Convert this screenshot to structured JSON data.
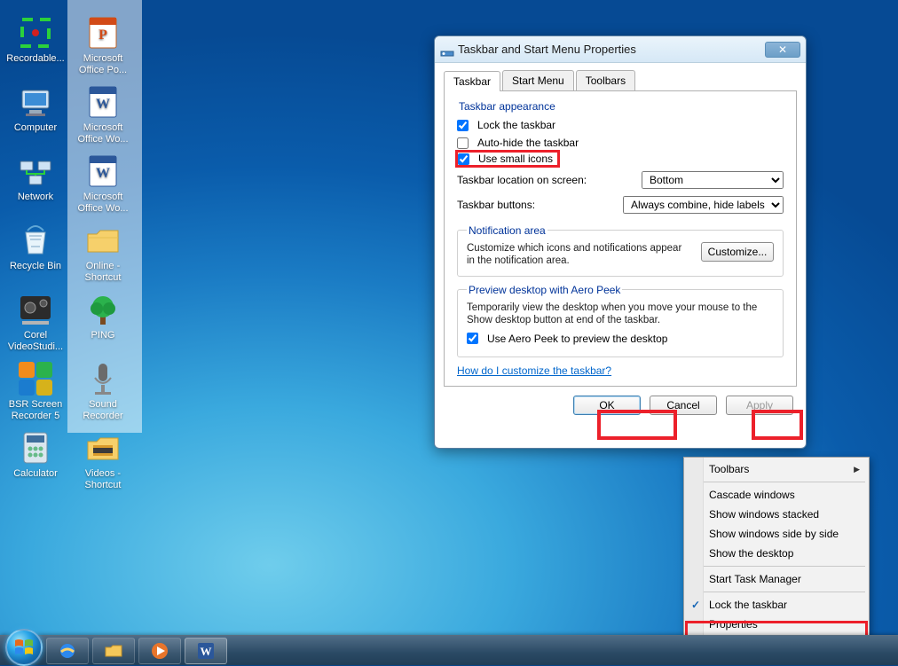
{
  "desktop": {
    "col1": [
      {
        "label": "Recordable...",
        "icon": "record"
      },
      {
        "label": "Computer",
        "icon": "computer"
      },
      {
        "label": "Network",
        "icon": "network"
      },
      {
        "label": "Recycle Bin",
        "icon": "recyclebin"
      },
      {
        "label": "Corel VideoStudi...",
        "icon": "corel"
      },
      {
        "label": "BSR Screen Recorder 5",
        "icon": "bsr"
      },
      {
        "label": "Calculator",
        "icon": "calculator"
      }
    ],
    "col2": [
      {
        "label": "Microsoft Office Po...",
        "icon": "pptx"
      },
      {
        "label": "Microsoft Office Wo...",
        "icon": "word"
      },
      {
        "label": "Microsoft Office Wo...",
        "icon": "word"
      },
      {
        "label": "Online - Shortcut",
        "icon": "folder"
      },
      {
        "label": "PING",
        "icon": "tree"
      },
      {
        "label": "Sound Recorder",
        "icon": "mic"
      },
      {
        "label": "Videos - Shortcut",
        "icon": "videos"
      }
    ]
  },
  "dialog": {
    "title": "Taskbar and Start Menu Properties",
    "tabs": {
      "taskbar": "Taskbar",
      "startmenu": "Start Menu",
      "toolbars": "Toolbars"
    },
    "group_appearance": {
      "title": "Taskbar appearance",
      "lock": "Lock the taskbar",
      "autohide": "Auto-hide the taskbar",
      "smallicons": "Use small icons",
      "location_label": "Taskbar location on screen:",
      "location_value": "Bottom",
      "buttons_label": "Taskbar buttons:",
      "buttons_value": "Always combine, hide labels"
    },
    "group_notif": {
      "title": "Notification area",
      "desc": "Customize which icons and notifications appear in the notification area.",
      "customize": "Customize..."
    },
    "group_peek": {
      "title": "Preview desktop with Aero Peek",
      "desc": "Temporarily view the desktop when you move your mouse to the Show desktop button at end of the taskbar.",
      "check": "Use Aero Peek to preview the desktop"
    },
    "help_link": "How do I customize the taskbar?",
    "buttons": {
      "ok": "OK",
      "cancel": "Cancel",
      "apply": "Apply"
    }
  },
  "context_menu": {
    "toolbars": "Toolbars",
    "cascade": "Cascade windows",
    "stacked": "Show windows stacked",
    "sidebyside": "Show windows side by side",
    "showdesktop": "Show the desktop",
    "taskmgr": "Start Task Manager",
    "lock": "Lock the taskbar",
    "properties": "Properties"
  }
}
